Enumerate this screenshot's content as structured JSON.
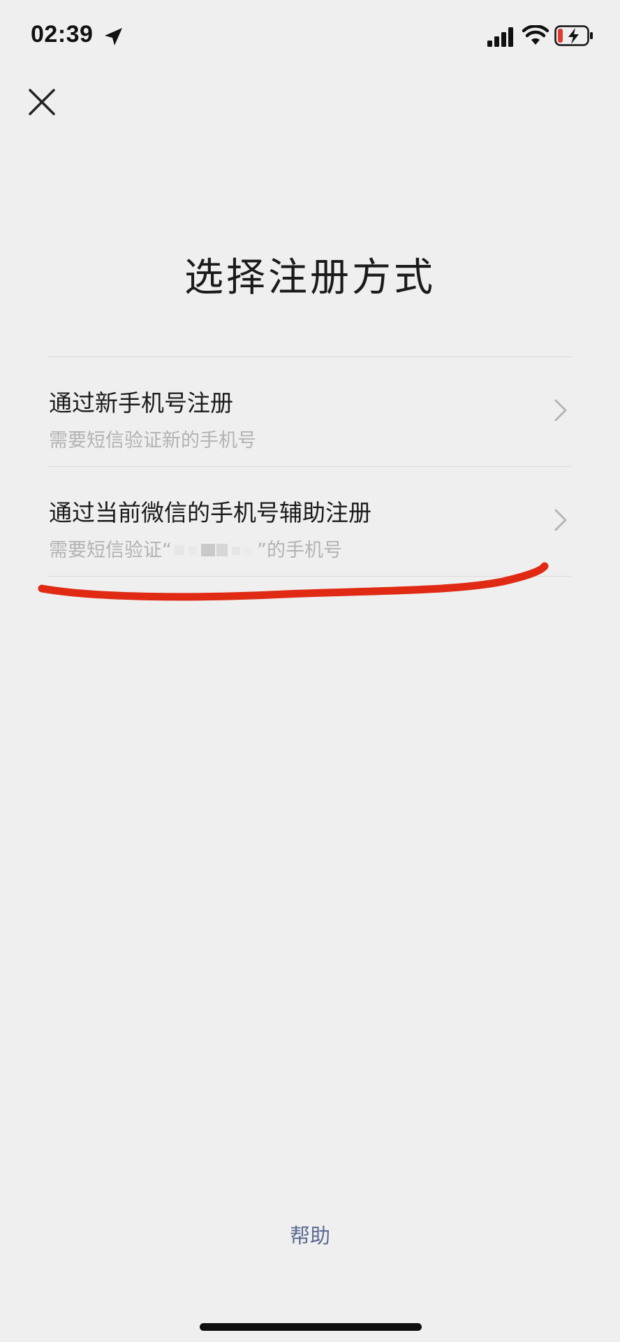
{
  "status_bar": {
    "time": "02:39",
    "icons": [
      "location-arrow-icon",
      "signal-icon",
      "wifi-icon",
      "battery-charging-icon"
    ],
    "battery_accent": "#e03b2f"
  },
  "header": {
    "close_icon": "close-icon"
  },
  "title": "选择注册方式",
  "options": [
    {
      "title": "通过新手机号注册",
      "subtitle": "需要短信验证新的手机号"
    },
    {
      "title": "通过当前微信的手机号辅助注册",
      "subtitle_prefix": "需要短信验证“",
      "subtitle_suffix": "”的手机号"
    }
  ],
  "annotation": {
    "underline_color": "#e02a14"
  },
  "help": {
    "label": "帮助",
    "color": "#5d6b93"
  }
}
